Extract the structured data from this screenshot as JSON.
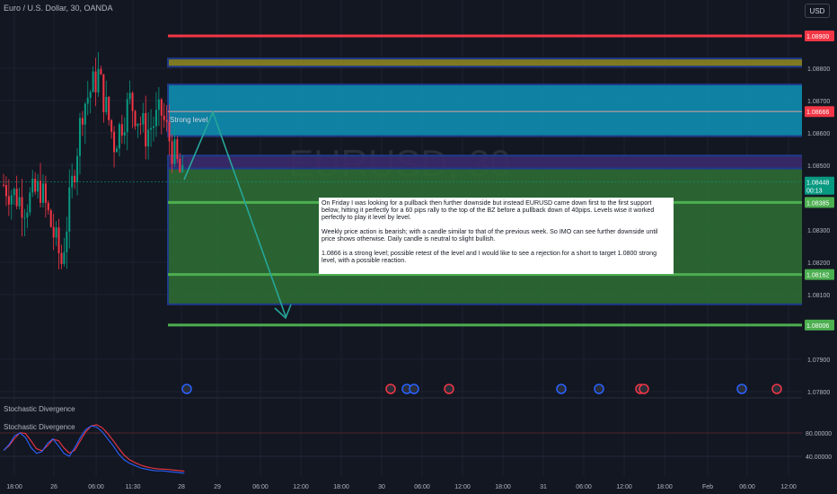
{
  "header": {
    "symbol": "Euro / U.S. Dollar, 30, OANDA",
    "currency_button": "USD"
  },
  "watermark": "EURUSD, 30",
  "price_axis": {
    "ticks": [
      "1.08800",
      "1.08700",
      "1.08600",
      "1.08500",
      "1.08300",
      "1.08200",
      "1.08100",
      "1.07900",
      "1.07800"
    ],
    "ticks_values": [
      1.088,
      1.087,
      1.086,
      1.085,
      1.083,
      1.082,
      1.081,
      1.079,
      1.078
    ],
    "badges": [
      {
        "text": "1.08900",
        "value": 1.089,
        "color": "#f23645"
      },
      {
        "text": "1.08666",
        "value": 1.08666,
        "color": "#f23645"
      },
      {
        "text": "1.08385",
        "value": 1.08385,
        "color": "#4caf50"
      },
      {
        "text": "1.08162",
        "value": 1.08162,
        "color": "#4caf50"
      },
      {
        "text": "1.08006",
        "value": 1.08006,
        "color": "#4caf50"
      }
    ],
    "current_price": {
      "text": "1.08448",
      "countdown": "00:13",
      "value": 1.08448,
      "color": "#089981"
    }
  },
  "time_axis": [
    "18:00",
    "26",
    "06:00",
    "11:30",
    "28",
    "29",
    "06:00",
    "12:00",
    "18:00",
    "30",
    "06:00",
    "12:00",
    "18:00",
    "31",
    "06:00",
    "12:00",
    "18:00",
    "Feb",
    "06:00",
    "12:00"
  ],
  "levels": [
    {
      "name": "resistance-1.08900",
      "value": 1.089,
      "color": "#f23645"
    },
    {
      "name": "strong-level-1.08666",
      "value": 1.08666,
      "color": "#9598a1",
      "label": "Strong level"
    },
    {
      "name": "support-1.08385",
      "value": 1.08385,
      "color": "#4caf50"
    },
    {
      "name": "support-1.08162",
      "value": 1.08162,
      "color": "#4caf50"
    },
    {
      "name": "target-1.08006",
      "value": 1.08006,
      "color": "#4caf50"
    }
  ],
  "zones": [
    {
      "name": "yellow-zone",
      "from": 1.08805,
      "to": 1.0883,
      "fill": "#8c8522",
      "border": "#1e3a8a"
    },
    {
      "name": "cyan-zone",
      "from": 1.0859,
      "to": 1.0875,
      "fill": "#0f8db0",
      "border": "#1e3a8a"
    },
    {
      "name": "purple-zone",
      "from": 1.0849,
      "to": 1.0853,
      "fill": "#3b2a6b",
      "border": "#1e3a8a"
    },
    {
      "name": "green-zone",
      "from": 1.0807,
      "to": 1.0849,
      "fill": "#2e6b33",
      "border": "#1e3a8a"
    }
  ],
  "note": {
    "paragraphs": [
      "On Friday I was looking for a pullback then further downside but instead EURUSD came down first to the first support below, hitting it perfectly for a 60 pips rally to the top of the BZ before a pullback down of 40pips. Levels wise it worked perfectly to play it level by level.",
      "Weekly price action is bearish; with a candle similar to that of the previous week. So IMO can see further downside until price shows otherwise. Daily candle is neutral to slight bullish.",
      "1.0866 is a strong level; possible retest of the level and I would like to see a rejection for a short to target 1.0800 strong level, with a possible reaction."
    ]
  },
  "indicator": {
    "title_main": "Stochastic Divergence",
    "title_pane": "Stochastic Divergence",
    "ticks": [
      "80.00000",
      "40.00000"
    ],
    "ticks_values": [
      80,
      40
    ]
  },
  "colors": {
    "bull": "#089981",
    "bear": "#f23645",
    "arrow": "#26a69a",
    "bg": "#131722"
  }
}
